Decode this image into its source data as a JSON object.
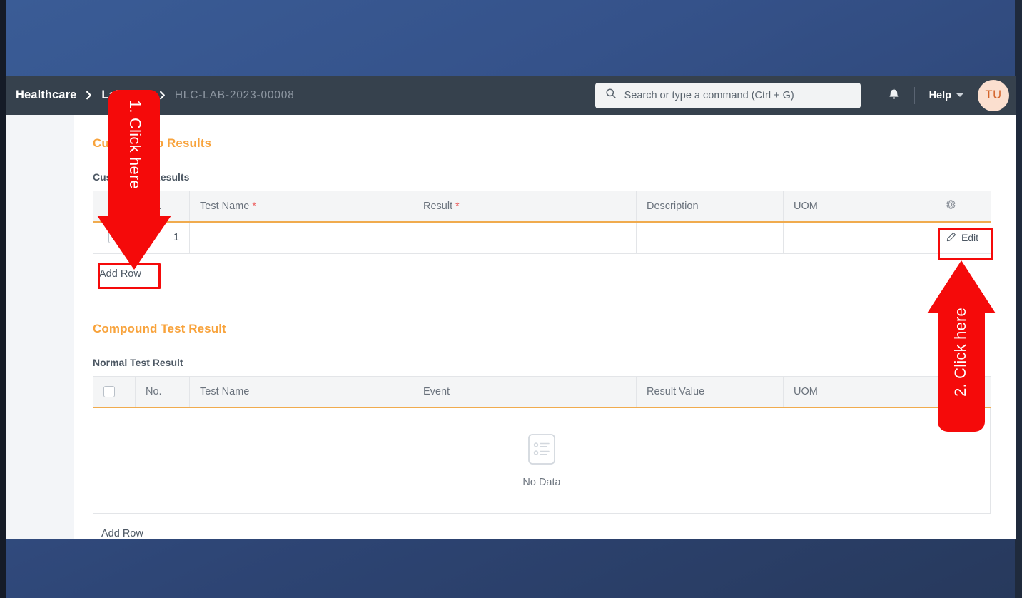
{
  "app": {
    "background_color": "#2f4c80",
    "navbar_color": "#36414d",
    "accent_color": "#f8a33c",
    "annotation_color": "#f50a0a"
  },
  "navbar": {
    "breadcrumb": [
      {
        "label": "Healthcare",
        "muted": false
      },
      {
        "label": "Lab Test",
        "muted": false
      },
      {
        "label": "HLC-LAB-2023-00008",
        "muted": true
      }
    ],
    "separator_icon": "chevron-right-icon",
    "search": {
      "icon": "search-icon",
      "placeholder": "Search or type a command (Ctrl + G)",
      "value": ""
    },
    "notifications_icon": "bell-icon",
    "help": {
      "label": "Help",
      "caret_icon": "chevron-down-icon"
    },
    "avatar": {
      "initials": "TU"
    }
  },
  "sections": [
    {
      "heading": "Custom Lab Results",
      "field_label": "Custom Lab Results",
      "table": {
        "columns": [
          {
            "key": "check",
            "label": "",
            "icon": "checkbox-icon",
            "required": false
          },
          {
            "key": "no",
            "label": "No.",
            "required": false
          },
          {
            "key": "name",
            "label": "Test Name",
            "required": true
          },
          {
            "key": "result",
            "label": "Result",
            "required": true
          },
          {
            "key": "desc",
            "label": "Description",
            "required": false
          },
          {
            "key": "uom",
            "label": "UOM",
            "required": false
          },
          {
            "key": "actions",
            "label": "",
            "icon": "gear-icon",
            "required": false
          }
        ],
        "rows": [
          {
            "no": "1",
            "name": "",
            "result": "",
            "desc": "",
            "uom": "",
            "action_label": "Edit",
            "action_icon": "pencil-icon"
          }
        ],
        "empty": false
      },
      "add_row_label": "Add Row"
    },
    {
      "heading": "Compound Test Result",
      "field_label": "Normal Test Result",
      "table": {
        "columns": [
          {
            "key": "check",
            "label": "",
            "icon": "checkbox-icon",
            "required": false
          },
          {
            "key": "no",
            "label": "No.",
            "required": false
          },
          {
            "key": "name",
            "label": "Test Name",
            "required": false
          },
          {
            "key": "event",
            "label": "Event",
            "required": false
          },
          {
            "key": "result_value",
            "label": "Result Value",
            "required": false
          },
          {
            "key": "uom",
            "label": "UOM",
            "required": false
          },
          {
            "key": "actions",
            "label": "",
            "required": false
          }
        ],
        "rows": [],
        "empty": true,
        "empty_label": "No Data",
        "empty_icon": "document-list-icon"
      },
      "add_row_label": "Add Row"
    }
  ],
  "annotations": {
    "arrow_one": {
      "label": "1. Click here",
      "direction": "down",
      "color": "#f50a0a"
    },
    "arrow_two": {
      "label": "2. Click here",
      "direction": "up",
      "color": "#f50a0a"
    },
    "highlight_add_row": "Add Row",
    "highlight_edit": "Edit"
  }
}
